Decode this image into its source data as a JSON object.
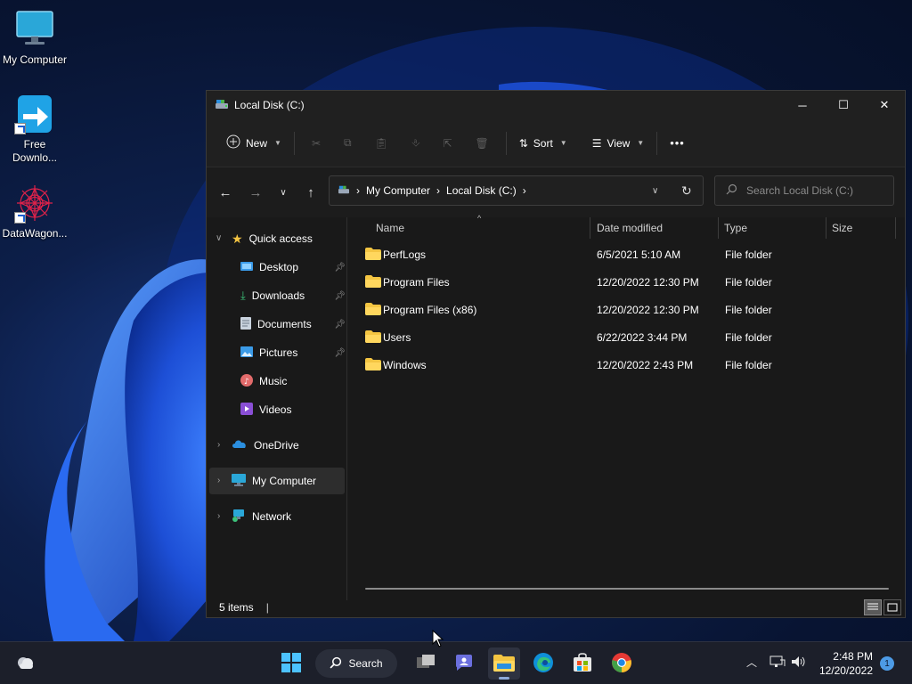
{
  "desktop": {
    "icons": [
      {
        "label": "My Computer",
        "icon": "monitor-icon"
      },
      {
        "label": "Free Downlo...",
        "icon": "download-arrow-icon"
      },
      {
        "label": "DataWagon...",
        "icon": "mandala-icon"
      }
    ]
  },
  "window": {
    "title": "Local Disk (C:)",
    "controls": {
      "minimize": "─",
      "maximize": "☐",
      "close": "✕"
    },
    "toolbar": {
      "new_label": "New",
      "sort_label": "Sort",
      "view_label": "View",
      "more_label": "•••",
      "icons": [
        "cut-icon",
        "copy-icon",
        "paste-icon",
        "rename-icon",
        "share-icon",
        "delete-icon"
      ]
    },
    "address": {
      "crumbs": [
        "My Computer",
        "Local Disk (C:)"
      ],
      "search_placeholder": "Search Local Disk (C:)"
    },
    "nav": {
      "quick_access": "Quick access",
      "items": [
        {
          "label": "Desktop",
          "pinned": true
        },
        {
          "label": "Downloads",
          "pinned": true
        },
        {
          "label": "Documents",
          "pinned": true
        },
        {
          "label": "Pictures",
          "pinned": true
        },
        {
          "label": "Music",
          "pinned": false
        },
        {
          "label": "Videos",
          "pinned": false
        }
      ],
      "onedrive": "OneDrive",
      "my_computer": "My Computer",
      "network": "Network"
    },
    "columns": {
      "name": "Name",
      "date": "Date modified",
      "type": "Type",
      "size": "Size"
    },
    "files": [
      {
        "name": "PerfLogs",
        "date": "6/5/2021 5:10 AM",
        "type": "File folder"
      },
      {
        "name": "Program Files",
        "date": "12/20/2022 12:30 PM",
        "type": "File folder"
      },
      {
        "name": "Program Files (x86)",
        "date": "12/20/2022 12:30 PM",
        "type": "File folder"
      },
      {
        "name": "Users",
        "date": "6/22/2022 3:44 PM",
        "type": "File folder"
      },
      {
        "name": "Windows",
        "date": "12/20/2022 2:43 PM",
        "type": "File folder"
      }
    ],
    "status": {
      "count": "5 items",
      "separator": "|"
    }
  },
  "taskbar": {
    "search_label": "Search",
    "time": "2:48 PM",
    "date": "12/20/2022",
    "notification_count": "1"
  },
  "colors": {
    "accent": "#4d9be6",
    "folder": "#f4c542",
    "window_bg": "#191919",
    "taskbar_bg": "#1c1f2a"
  }
}
